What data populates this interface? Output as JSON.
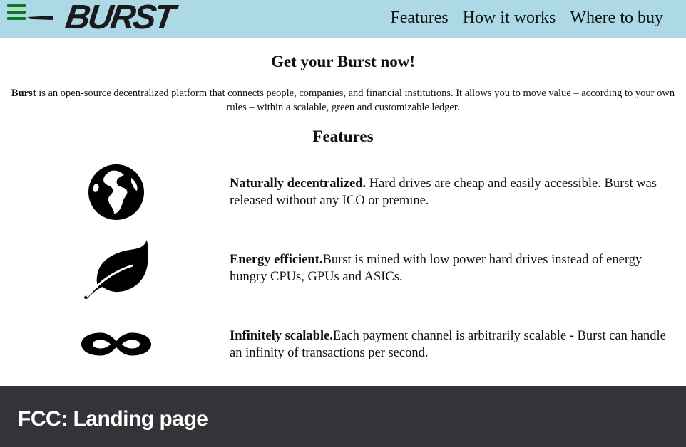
{
  "header": {
    "logo_text": "BURST",
    "nav": [
      "Features",
      "How it works",
      "Where to buy"
    ]
  },
  "hero": {
    "title": "Get your Burst now!",
    "intro_bold": "Burst",
    "intro_rest": " is an open-source decentralized platform that connects people, companies, and financial institutions. It allows you to move value – according to your own rules – within a scalable, green and customizable ledger."
  },
  "features": {
    "title": "Features",
    "items": [
      {
        "icon": "globe-icon",
        "bold": "Naturally decentralized.",
        "text": " Hard drives are cheap and easily accessible. Burst was released without any ICO or premine."
      },
      {
        "icon": "leaf-icon",
        "bold": "Energy efficient.",
        "text": "Burst is mined with low power hard drives instead of energy hungry CPUs, GPUs and ASICs."
      },
      {
        "icon": "infinity-icon",
        "bold": "Infinitely scalable.",
        "text": "Each payment channel is arbitrarily scalable - Burst can handle an infinity of transactions per second."
      }
    ]
  },
  "footer": {
    "title": "FCC: Landing page"
  },
  "colors": {
    "header_bg": "#add8e6",
    "menu_icon": "#0b7a14",
    "footer_bg": "#333338"
  }
}
